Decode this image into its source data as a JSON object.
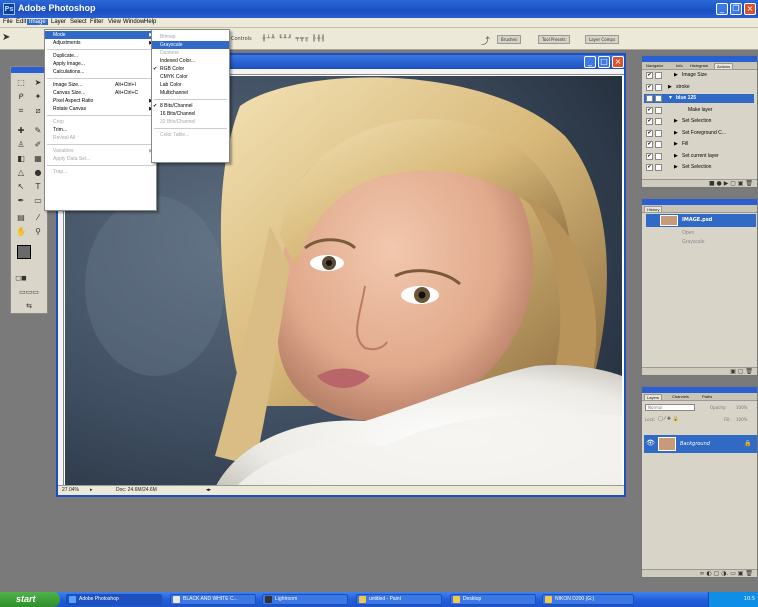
{
  "app": {
    "title": "Adobe Photoshop"
  },
  "menubar": [
    "File",
    "Edit",
    "Image",
    "Layer",
    "Select",
    "Filter",
    "View",
    "Window",
    "Help"
  ],
  "options_bar": {
    "controls_label": "Controls",
    "panel_tabs": [
      "Brushes",
      "Tool Presets",
      "Layer Comps"
    ]
  },
  "image_menu": {
    "items": [
      {
        "label": "Mode",
        "shortcut": "",
        "submenu": true,
        "state": "highlighted"
      },
      {
        "label": "Adjustments",
        "shortcut": "",
        "submenu": true,
        "state": "normal"
      },
      {
        "label": "Duplicate...",
        "shortcut": "",
        "submenu": false,
        "state": "normal"
      },
      {
        "label": "Apply Image...",
        "shortcut": "",
        "submenu": false,
        "state": "normal"
      },
      {
        "label": "Calculations...",
        "shortcut": "",
        "submenu": false,
        "state": "normal"
      },
      {
        "label": "Image Size...",
        "shortcut": "Alt+Ctrl+I",
        "submenu": false,
        "state": "normal"
      },
      {
        "label": "Canvas Size...",
        "shortcut": "Alt+Ctrl+C",
        "submenu": false,
        "state": "normal"
      },
      {
        "label": "Pixel Aspect Ratio",
        "shortcut": "",
        "submenu": true,
        "state": "normal"
      },
      {
        "label": "Rotate Canvas",
        "shortcut": "",
        "submenu": true,
        "state": "normal"
      },
      {
        "label": "Crop",
        "shortcut": "",
        "submenu": false,
        "state": "disabled"
      },
      {
        "label": "Trim...",
        "shortcut": "",
        "submenu": false,
        "state": "normal"
      },
      {
        "label": "Reveal All",
        "shortcut": "",
        "submenu": false,
        "state": "disabled"
      },
      {
        "label": "Variables",
        "shortcut": "",
        "submenu": true,
        "state": "disabled"
      },
      {
        "label": "Apply Data Set...",
        "shortcut": "",
        "submenu": false,
        "state": "disabled"
      },
      {
        "label": "Trap...",
        "shortcut": "",
        "submenu": false,
        "state": "disabled"
      }
    ]
  },
  "mode_submenu": {
    "items": [
      {
        "label": "Bitmap",
        "checked": false,
        "state": "disabled"
      },
      {
        "label": "Grayscale",
        "checked": false,
        "state": "highlighted"
      },
      {
        "label": "Duotone",
        "checked": false,
        "state": "disabled"
      },
      {
        "label": "Indexed Color...",
        "checked": false,
        "state": "normal"
      },
      {
        "label": "RGB Color",
        "checked": true,
        "state": "normal"
      },
      {
        "label": "CMYK Color",
        "checked": false,
        "state": "normal"
      },
      {
        "label": "Lab Color",
        "checked": false,
        "state": "normal"
      },
      {
        "label": "Multichannel",
        "checked": false,
        "state": "normal"
      },
      {
        "label": "8 Bits/Channel",
        "checked": true,
        "state": "normal"
      },
      {
        "label": "16 Bits/Channel",
        "checked": false,
        "state": "normal"
      },
      {
        "label": "32 Bits/Channel",
        "checked": false,
        "state": "disabled"
      },
      {
        "label": "Color Table...",
        "checked": false,
        "state": "disabled"
      }
    ]
  },
  "document": {
    "zoom": "27.04%",
    "doc_size": "Doc: 24.6M/24.6M"
  },
  "actions_panel": {
    "tabs": [
      "Navigator",
      "Info",
      "Histogram",
      "Actions"
    ],
    "active_tab": "Actions",
    "rows": [
      {
        "label": "Image Size",
        "checked": true,
        "expanded": false,
        "level": 1
      },
      {
        "label": "stroke",
        "checked": true,
        "expanded": false,
        "level": 0
      },
      {
        "label": "blue 125",
        "checked": true,
        "expanded": true,
        "level": 0,
        "selected": true
      },
      {
        "label": "Make layer",
        "checked": true,
        "expanded": false,
        "level": 2
      },
      {
        "label": "Set Selection",
        "checked": true,
        "expanded": false,
        "level": 1
      },
      {
        "label": "Set Foreground C...",
        "checked": true,
        "expanded": false,
        "level": 1
      },
      {
        "label": "Fill",
        "checked": true,
        "expanded": false,
        "level": 1
      },
      {
        "label": "Set current layer",
        "checked": true,
        "expanded": false,
        "level": 1
      },
      {
        "label": "Set Selection",
        "checked": true,
        "expanded": false,
        "level": 1
      }
    ]
  },
  "history_panel": {
    "tab": "History",
    "snapshot": "IMAGE.psd",
    "states": [
      "Open",
      "Grayscale"
    ]
  },
  "layers_panel": {
    "tabs": [
      "Layers",
      "Channels",
      "Paths"
    ],
    "active_tab": "Layers",
    "blend_mode": "Normal",
    "opacity_label": "Opacity:",
    "opacity_value": "100%",
    "lock_label": "Lock:",
    "fill_label": "Fill:",
    "fill_value": "100%",
    "layers": [
      {
        "name": "Background",
        "locked": true,
        "visible": true
      }
    ]
  },
  "taskbar": {
    "start_label": "start",
    "buttons": [
      {
        "label": "Adobe Photoshop",
        "active": true,
        "icon_color": "#5aa0ff"
      },
      {
        "label": "BLACK AND WHITE C...",
        "active": false,
        "icon_color": "#e8e8e8"
      },
      {
        "label": "Lightroom",
        "active": false,
        "icon_color": "#333333"
      },
      {
        "label": "untitled - Paint",
        "active": false,
        "icon_color": "#f2c84b"
      },
      {
        "label": "Desktop",
        "active": false,
        "icon_color": "#f2c84b"
      },
      {
        "label": "NIKON D200 (G:)",
        "active": false,
        "icon_color": "#f2c84b"
      }
    ],
    "clock": "10:5"
  },
  "colors": {
    "xp_blue": "#1c4fc0",
    "menu_highlight": "#316ac5",
    "start_green": "#3a9b35"
  }
}
